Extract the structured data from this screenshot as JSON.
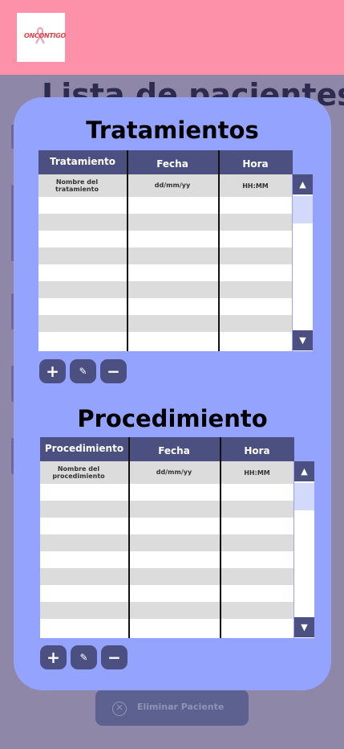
{
  "logo": {
    "text": "ONCONTIGO",
    "icon": "ribbon-icon"
  },
  "background_page": {
    "title": "Lista de pacientes"
  },
  "delete_patient": {
    "label": "Eliminar Paciente",
    "icon": "close-circle-icon"
  },
  "treatments": {
    "title": "Tratamientos",
    "columns": [
      "Tratamiento",
      "Fecha",
      "Hora"
    ],
    "first_row": {
      "name": "Nombre del tratamiento",
      "date": "dd/mm/yy",
      "time": "HH:MM"
    },
    "scroll_up": "▲",
    "scroll_down": "▼",
    "actions": {
      "add": "+",
      "edit": "✎",
      "remove": "−"
    }
  },
  "procedures": {
    "title": "Procedimiento",
    "columns": [
      "Procedimiento",
      "Fecha",
      "Hora"
    ],
    "first_row": {
      "name": "Nombre del procedimiento",
      "date": "dd/mm/yy",
      "time": "HH:MM"
    },
    "scroll_up": "▲",
    "scroll_down": "▼",
    "actions": {
      "add": "+",
      "edit": "✎",
      "remove": "−"
    }
  },
  "colors": {
    "top_bar": "#fe91aa",
    "modal": "#94a4fe",
    "header": "#4b5080",
    "overlay": "#8e87a8"
  }
}
